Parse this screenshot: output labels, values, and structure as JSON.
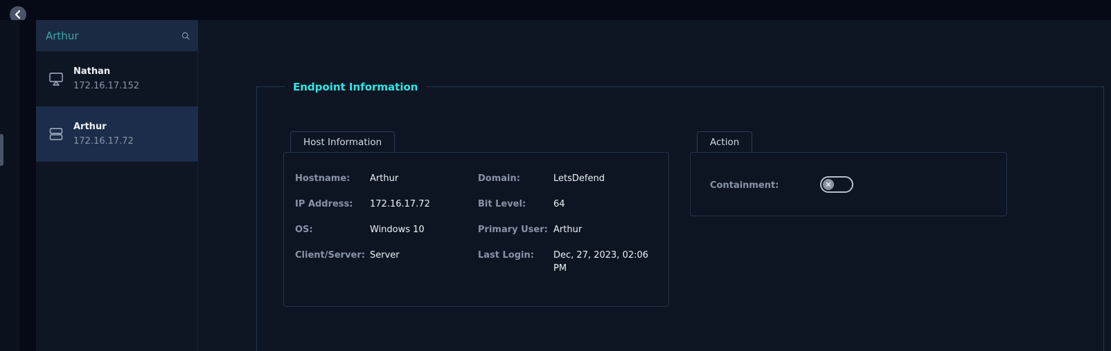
{
  "search": {
    "value": "Arthur"
  },
  "hosts": [
    {
      "name": "Nathan",
      "ip": "172.16.17.152",
      "icon": "monitor-icon"
    },
    {
      "name": "Arthur",
      "ip": "172.16.17.72",
      "icon": "server-icon"
    }
  ],
  "endpoint": {
    "title": "Endpoint Information",
    "host_info": {
      "tab_label": "Host Information",
      "hostname_label": "Hostname:",
      "hostname": "Arthur",
      "ip_label": "IP Address:",
      "ip": "172.16.17.72",
      "os_label": "OS:",
      "os": "Windows 10",
      "client_server_label": "Client/Server:",
      "client_server": "Server",
      "domain_label": "Domain:",
      "domain": "LetsDefend",
      "bit_level_label": "Bit Level:",
      "bit_level": "64",
      "primary_user_label": "Primary User:",
      "primary_user": "Arthur",
      "last_login_label": "Last Login:",
      "last_login": "Dec, 27, 2023, 02:06 PM"
    },
    "action": {
      "tab_label": "Action",
      "containment_label": "Containment:",
      "containment_enabled": false
    }
  },
  "colors": {
    "accent": "#2ee6e6",
    "search_text": "#3aa8a8",
    "selected_row": "#1b2d4a"
  }
}
